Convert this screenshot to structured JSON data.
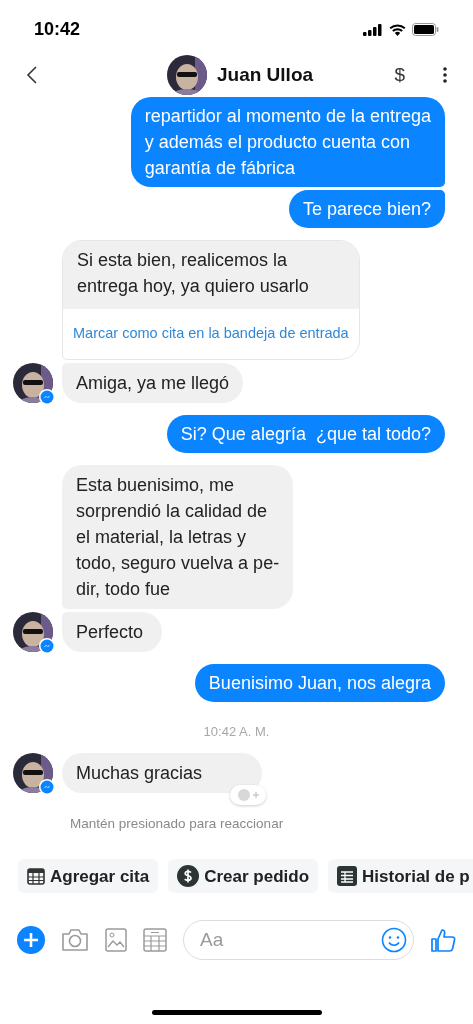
{
  "status_bar": {
    "time": "10:42"
  },
  "header": {
    "name": "Juan Ulloa",
    "action": "$"
  },
  "messages": [
    {
      "kind": "sent",
      "text": "repartidor al momento de la entrega\ny además el producto cuenta con\ngarantía de fábrica"
    },
    {
      "kind": "sent",
      "text": "Te parece bien?"
    },
    {
      "kind": "received",
      "text": "Si esta bien, realicemos la\nentrega hoy, ya quiero usarlo",
      "link": "Marcar como cita en la bandeja de entrada",
      "avatar": false
    },
    {
      "kind": "received",
      "text": "Amiga, ya me llegó",
      "avatar": true
    },
    {
      "kind": "sent",
      "text": "Si? Que alegría  ¿que tal todo?"
    },
    {
      "kind": "received",
      "text": "Esta buenisimo, me\nsorprendió la calidad de\nel material, la letras y\ntodo, seguro vuelva a pe-\ndir, todo fue",
      "avatar": false
    },
    {
      "kind": "received",
      "text": "Perfecto",
      "avatar": true
    },
    {
      "kind": "sent",
      "text": "Buenisimo Juan, nos alegra"
    },
    {
      "kind": "timestamp",
      "text": "10:42 A. M."
    },
    {
      "kind": "received",
      "text": "Muchas gracias",
      "avatar": true,
      "reaction": true
    },
    {
      "kind": "hint",
      "text": "Mantén presionado para reaccionar"
    }
  ],
  "quick_replies": [
    {
      "kind": "calendar",
      "label": "Agregar cita"
    },
    {
      "kind": "dollar",
      "label": "Crear pedido"
    },
    {
      "kind": "list",
      "label": "Historial de p"
    }
  ],
  "composer": {
    "placeholder": "Aa"
  }
}
